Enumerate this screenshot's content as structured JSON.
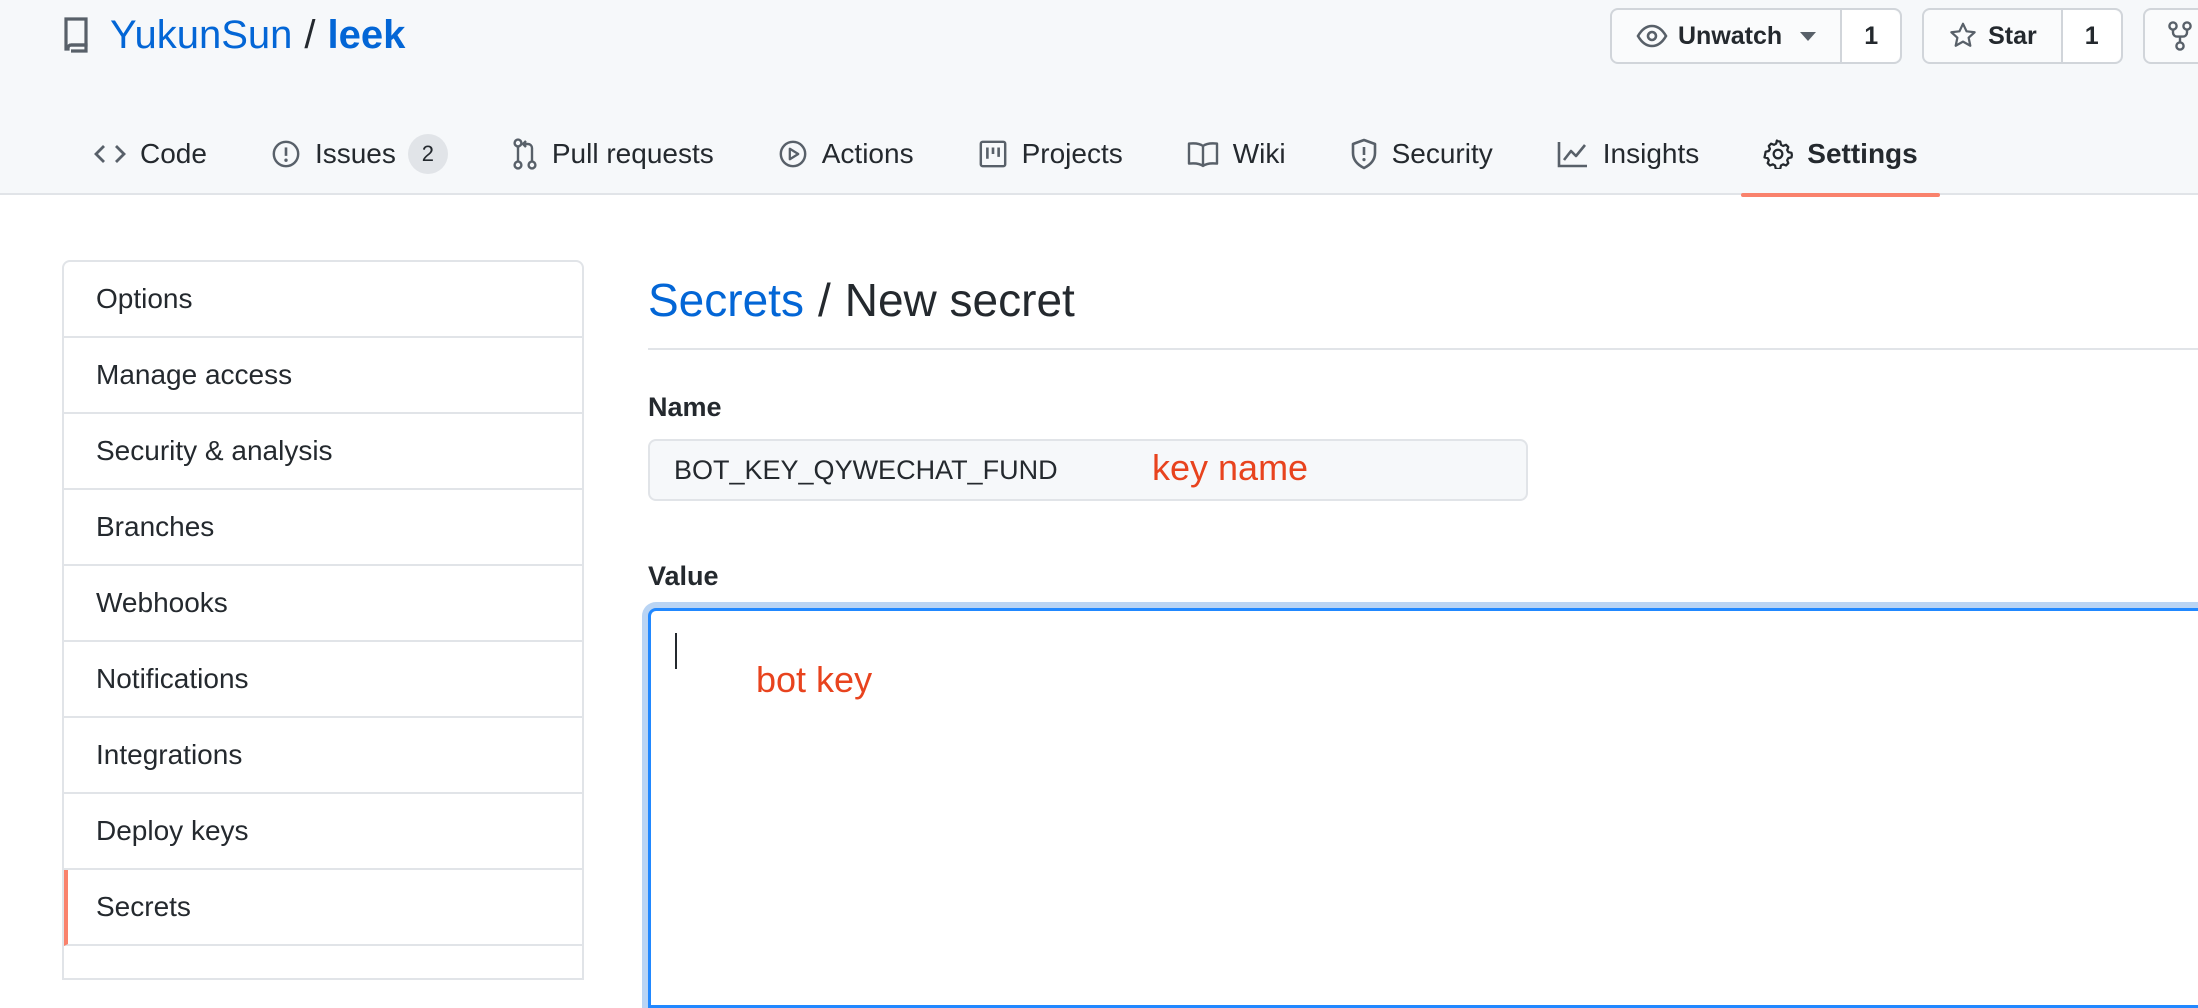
{
  "repo": {
    "owner": "YukunSun",
    "separator": "/",
    "name": "leek"
  },
  "actions": {
    "watch_label": "Unwatch",
    "watch_count": "1",
    "star_label": "Star",
    "star_count": "1"
  },
  "nav": {
    "items": [
      {
        "label": "Code",
        "icon": "code-icon"
      },
      {
        "label": "Issues",
        "icon": "issue-icon",
        "counter": "2"
      },
      {
        "label": "Pull requests",
        "icon": "pull-request-icon"
      },
      {
        "label": "Actions",
        "icon": "play-icon"
      },
      {
        "label": "Projects",
        "icon": "project-icon"
      },
      {
        "label": "Wiki",
        "icon": "book-icon"
      },
      {
        "label": "Security",
        "icon": "shield-icon"
      },
      {
        "label": "Insights",
        "icon": "graph-icon"
      },
      {
        "label": "Settings",
        "icon": "gear-icon",
        "selected": true
      }
    ]
  },
  "sidebar": {
    "items": [
      {
        "label": "Options"
      },
      {
        "label": "Manage access"
      },
      {
        "label": "Security & analysis"
      },
      {
        "label": "Branches"
      },
      {
        "label": "Webhooks"
      },
      {
        "label": "Notifications"
      },
      {
        "label": "Integrations"
      },
      {
        "label": "Deploy keys"
      },
      {
        "label": "Secrets",
        "selected": true
      }
    ]
  },
  "main": {
    "breadcrumb_link": "Secrets",
    "breadcrumb_sep": "/",
    "breadcrumb_current": "New secret",
    "name_label": "Name",
    "name_value": "BOT_KEY_QYWECHAT_FUND",
    "name_annotation": "key name",
    "value_label": "Value",
    "value_annotation": "bot key"
  },
  "colors": {
    "link": "#0366d6",
    "selected_underline": "#f9826c",
    "annotation": "#e8431e",
    "focus_border": "#2188ff"
  }
}
